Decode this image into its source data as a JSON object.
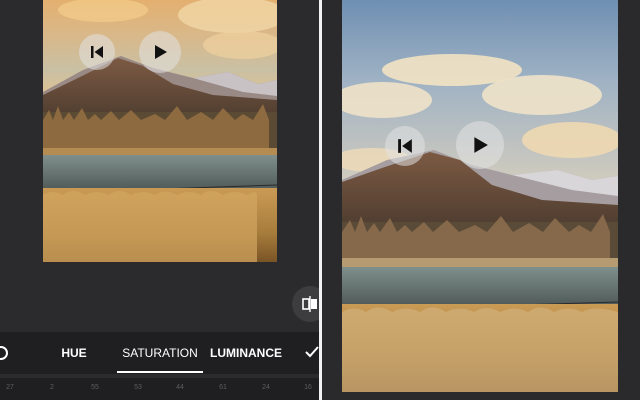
{
  "tabs": [
    {
      "label": "HUE",
      "active": false
    },
    {
      "label": "SATURATION",
      "active": true
    },
    {
      "label": "LUMINANCE",
      "active": false
    }
  ],
  "channel_values": [
    "27",
    "2",
    "55",
    "53",
    "44",
    "61",
    "24",
    "16"
  ],
  "controls": {
    "previous_icon": "skip-back-icon",
    "play_icon": "play-icon",
    "compare_icon": "compare-split-icon",
    "reset_icon": "circle-icon",
    "confirm_icon": "checkmark-icon"
  },
  "colors": {
    "panel_bg": "#2b2b2d",
    "toolbar_bg": "#1f1f21",
    "accent": "#ffffff",
    "muted_text": "#5d5d5f"
  }
}
